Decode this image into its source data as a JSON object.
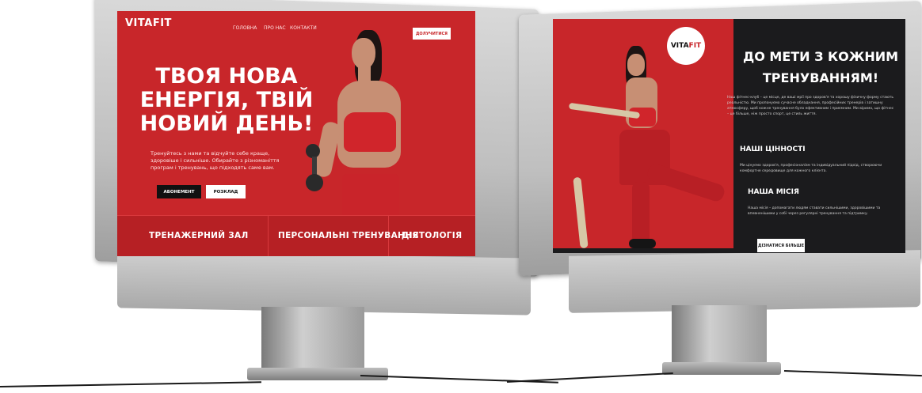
{
  "left_site": {
    "logo": {
      "part1": "VITA",
      "part2": "FIT"
    },
    "nav": [
      "ГОЛОВНА",
      "ПРО НАС",
      "КОНТАКТИ"
    ],
    "join_button": "ДОЛУЧИТИСЯ",
    "hero_title": [
      "ТВОЯ НОВА",
      "ЕНЕРГІЯ, ТВІЙ",
      "НОВИЙ ДЕНЬ!"
    ],
    "hero_subtitle": "Тренуйтесь з нами та відчуйте себе краще, здоровіше і сильніше. Обирайте з різноманіття програм і тренувань, що підходять саме вам.",
    "buttons": {
      "primary": "АБОНЕМЕНТ",
      "secondary": "РОЗКЛАД"
    },
    "services": [
      "ТРЕНАЖЕРНИЙ ЗАЛ",
      "ПЕРСОНАЛЬНІ ТРЕНУВАННЯ",
      "ДІЄТОЛОГІЯ"
    ]
  },
  "right_site": {
    "logo": {
      "part1": "VITA",
      "part2": "FIT"
    },
    "title": [
      "ДО МЕТИ З КОЖНИМ",
      "ТРЕНУВАННЯМ!"
    ],
    "intro": "Наш фітнес-клуб – це місце, де ваші мрії про здоров'я та хорошу фізичну форму стають реальністю. Ми пропонуємо сучасне обладнання, професійних тренерів і затишну атмосферу, щоб кожне тренування було ефективним і приємним. Ми віримо, що фітнес – це більше, ніж просто спорт, це стиль життя.",
    "values_heading": "НАШІ ЦІННОСТІ",
    "values_text": "Ми цінуємо здоров'я, професіоналізм та індивідуальний підхід, створюючи комфортне середовище для кожного клієнта.",
    "mission_heading": "НАША МІСІЯ",
    "mission_text": "Наша місія – допомагати людям ставати сильнішими, здоровішими та впевненішими у собі через регулярні тренування та підтримку.",
    "more_button": "ДІЗНАТИСЯ БІЛЬШЕ"
  },
  "colors": {
    "brand_red": "#c8262a",
    "dark": "#1b1b1d",
    "white": "#ffffff"
  }
}
